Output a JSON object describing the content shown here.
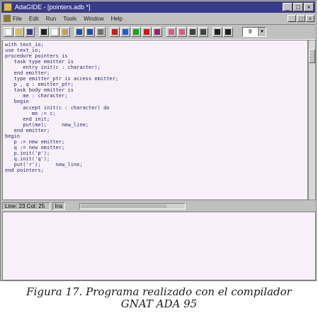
{
  "window": {
    "title": "AdaGIDE - [pointers.adb *]",
    "controls": [
      "_",
      "□",
      "×"
    ]
  },
  "menubar": {
    "items": [
      "File",
      "Edit",
      "Run",
      "Tools",
      "Window",
      "Help"
    ],
    "mdi_controls": [
      "_",
      "□",
      "×"
    ]
  },
  "toolbar": {
    "buttons": [
      {
        "name": "new-file-icon",
        "color": "#ffffff"
      },
      {
        "name": "open-file-icon",
        "color": "#d8c050"
      },
      {
        "name": "save-icon",
        "color": "#304080"
      },
      {
        "name": "cut-icon",
        "color": "#202020"
      },
      {
        "name": "copy-icon",
        "color": "#ffffff"
      },
      {
        "name": "paste-icon",
        "color": "#c0a060"
      },
      {
        "name": "undo-icon",
        "color": "#2050a0"
      },
      {
        "name": "redo-icon",
        "color": "#2050a0"
      },
      {
        "name": "find-icon",
        "color": "#707070"
      },
      {
        "name": "compile-icon",
        "color": "#c02020"
      },
      {
        "name": "build-icon",
        "color": "#2060c0"
      },
      {
        "name": "run-icon",
        "color": "#20a020"
      },
      {
        "name": "stop-icon",
        "color": "#c02020"
      },
      {
        "name": "debug-icon",
        "color": "#8a2a6a"
      },
      {
        "name": "indent-icon",
        "color": "#d06080"
      },
      {
        "name": "outdent-icon",
        "color": "#d06080"
      },
      {
        "name": "block-comment-icon",
        "color": "#404040"
      },
      {
        "name": "uncomment-icon",
        "color": "#404040"
      },
      {
        "name": "format-icon",
        "color": "#202020"
      },
      {
        "name": "help-icon",
        "color": "#202020"
      }
    ],
    "combo_value": "8"
  },
  "editor": {
    "code_color": "#2a2a6a",
    "lines": [
      "with text_io;",
      "use text_io;",
      "procedure pointers is",
      "   task type emitter is",
      "      entry init(c : character);",
      "   end emitter;",
      "   type emitter_ptr is access emitter;",
      "   p , q : emitter_ptr;",
      "   task body emitter is",
      "      me : character;",
      "   begin",
      "      accept init(c : character) do",
      "         me := c;",
      "      end init;",
      "      put(me);     new_line;",
      "   end emitter;",
      "begin",
      "   p := new emitter;",
      "   q := new emitter;",
      "   p.init('p');",
      "   q.init('q');",
      "   put('r');     new_line;",
      "end pointers;"
    ]
  },
  "status": {
    "position": "Line: 23 Col: 25",
    "mode": "Ins"
  },
  "caption": {
    "line1": "Figura 17. Programa realizado con el compilador",
    "line2": "GNAT ADA 95"
  }
}
